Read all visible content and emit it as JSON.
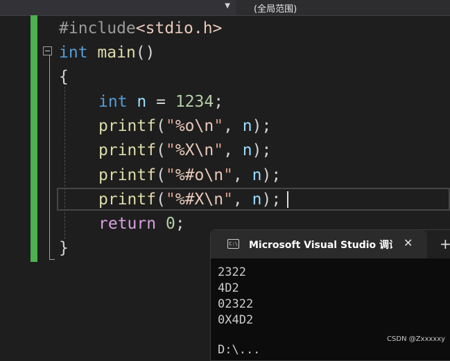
{
  "toolbar": {
    "scope_label": "(全局范围)"
  },
  "editor": {
    "lines": {
      "l1": {
        "directive": "#include",
        "header": "<stdio.h>"
      },
      "l2": {
        "type": "int",
        "name": "main",
        "parens": "()"
      },
      "l3": {
        "brace": "{"
      },
      "l4": {
        "type": "int",
        "var": "n",
        "op": " = ",
        "value": "1234",
        "end": ";"
      },
      "l5": {
        "fn": "printf",
        "open": "(",
        "q1": "\"",
        "fmt": "%o",
        "esc": "\\n",
        "q2": "\"",
        "comma": ", ",
        "arg": "n",
        "close": ");"
      },
      "l6": {
        "fn": "printf",
        "open": "(",
        "q1": "\"",
        "fmt": "%X",
        "esc": "\\n",
        "q2": "\"",
        "comma": ", ",
        "arg": "n",
        "close": ");"
      },
      "l7": {
        "fn": "printf",
        "open": "(",
        "q1": "\"",
        "fmt": "%#o",
        "esc": "\\n",
        "q2": "\"",
        "comma": ", ",
        "arg": "n",
        "close": ");"
      },
      "l8": {
        "fn": "printf",
        "open": "(",
        "q1": "\"",
        "fmt": "%#X",
        "esc": "\\n",
        "q2": "\"",
        "comma": ", ",
        "arg": "n",
        "close": ");"
      },
      "l9": {
        "kw": "return",
        "value": "0",
        "end": ";"
      },
      "l10": {
        "brace": "}"
      }
    }
  },
  "console": {
    "icon_text": "C:\\",
    "title": "Microsoft Visual Studio 调试控制台",
    "close_glyph": "✕",
    "new_tab_glyph": "+",
    "output": [
      "2322",
      "4D2",
      "02322",
      "0X4D2"
    ],
    "tail": "D:\\..."
  },
  "watermark": "CSDN @Zxxxxxy",
  "colors": {
    "gutter_changed": "#4eb04e",
    "keyword": "#569cd6",
    "function": "#dcdcaa",
    "string": "#d69d85",
    "number": "#b5cea8",
    "identifier": "#9cdcfe",
    "control": "#d8a0df"
  },
  "icons": {
    "scope_dropdown": "chevron-down-icon",
    "collapse": "minus-box-icon",
    "console": "console-icon",
    "close": "close-icon",
    "new_tab": "plus-icon"
  }
}
